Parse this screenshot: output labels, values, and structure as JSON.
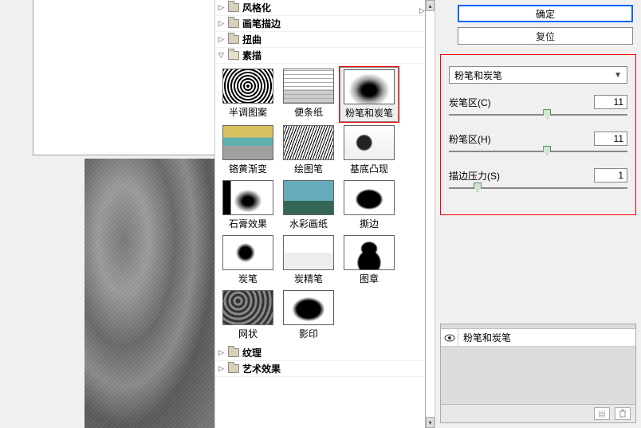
{
  "buttons": {
    "ok": "确定",
    "reset": "复位"
  },
  "categories": {
    "stylize": "风格化",
    "brush": "画笔描边",
    "distort": "扭曲",
    "sketch": "素描",
    "texture": "纹理",
    "artistic": "艺术效果"
  },
  "sketch_thumbs": [
    "半调图案",
    "便条纸",
    "粉笔和炭笔",
    "铬黄渐变",
    "绘图笔",
    "基底凸现",
    "石膏效果",
    "水彩画纸",
    "撕边",
    "炭笔",
    "炭精笔",
    "图章",
    "网状",
    "影印"
  ],
  "filter_dropdown": "粉笔和炭笔",
  "params": {
    "charcoal": {
      "label": "炭笔区(C)",
      "value": "11",
      "pos": 55
    },
    "chalk": {
      "label": "粉笔区(H)",
      "value": "11",
      "pos": 55
    },
    "stroke": {
      "label": "描边压力(S)",
      "value": "1",
      "pos": 16
    }
  },
  "layer_label": "粉笔和炭笔"
}
